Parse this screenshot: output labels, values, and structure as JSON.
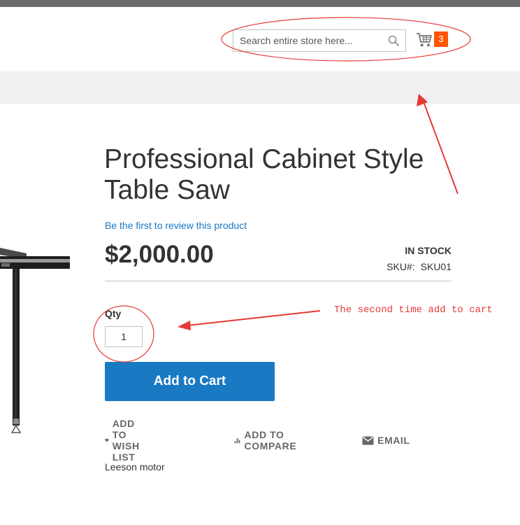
{
  "header": {
    "search": {
      "placeholder": "Search entire store here...",
      "value": ""
    },
    "cart": {
      "count": "3"
    }
  },
  "product": {
    "title": "Professional Cabinet Style Table Saw",
    "review_link": "Be the first to review this product",
    "price": "$2,000.00",
    "stock_status": "IN STOCK",
    "sku_label": "SKU#:",
    "sku_value": "SKU01",
    "qty_label": "Qty",
    "qty_value": "1",
    "add_to_cart_label": "Add to Cart",
    "actions": {
      "wishlist": "ADD TO WISH LIST",
      "compare": "ADD TO COMPARE",
      "email": "EMAIL"
    },
    "description": "Leeson motor"
  },
  "annotation": {
    "note": "The second time add to cart",
    "color": "#e53935"
  },
  "colors": {
    "accent": "#1979c3",
    "cart_badge": "#ff5501",
    "top_bar": "#6b6b6b",
    "nav_band": "#f0f0f0"
  },
  "icons": [
    "search-icon",
    "cart-icon",
    "heart-icon",
    "bar-chart-icon",
    "envelope-icon"
  ]
}
